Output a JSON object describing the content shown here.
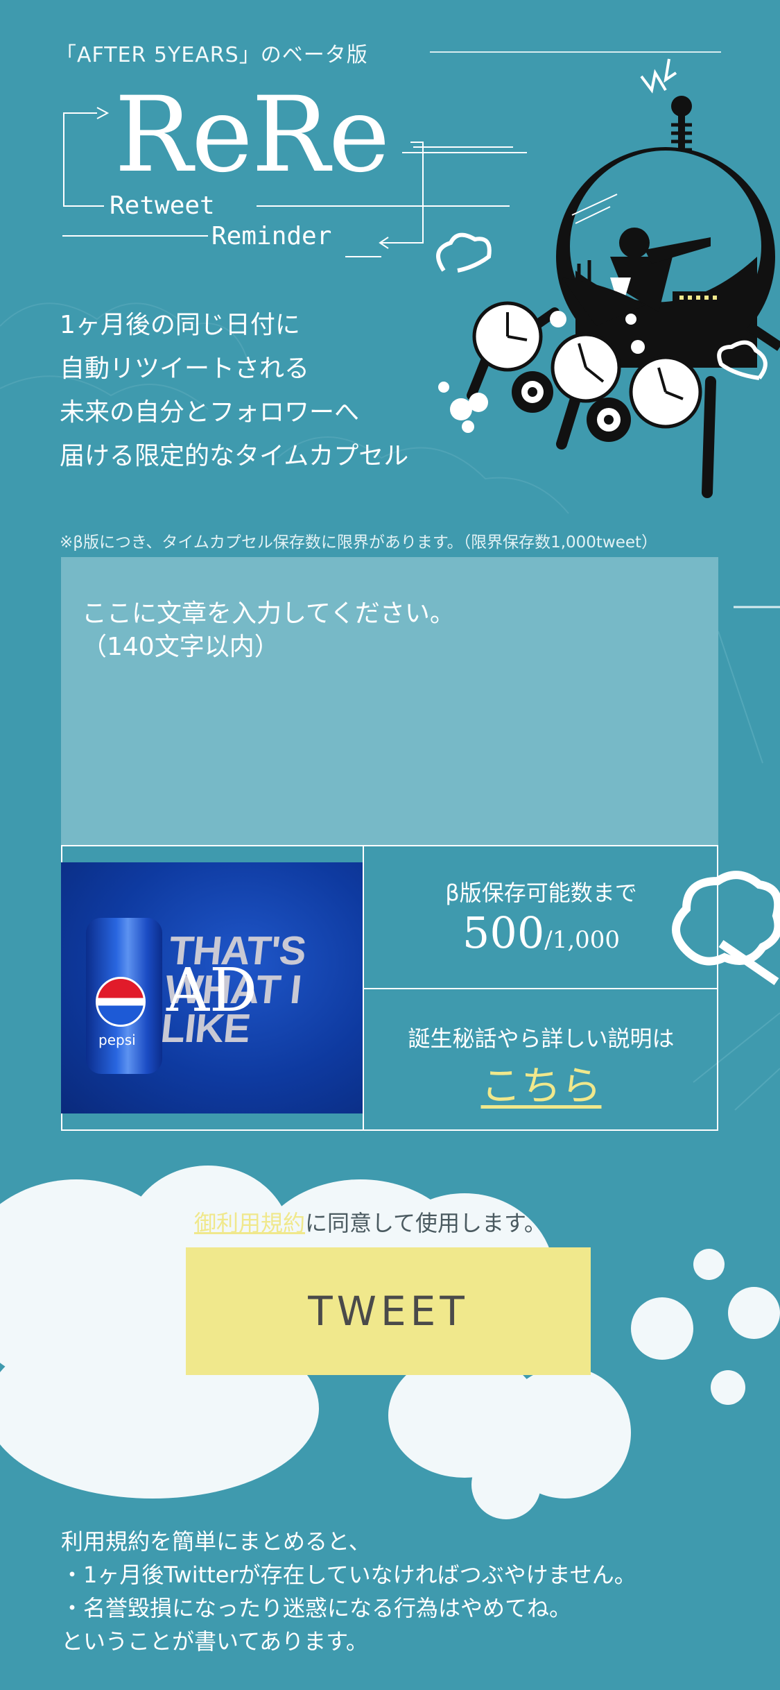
{
  "header": {
    "beta_tag": "「AFTER 5YEARS」のベータ版",
    "logo": "ReRe",
    "logo_sub1": "Retweet",
    "logo_sub2": "Reminder"
  },
  "intro": {
    "lines": [
      "1ヶ月後の同じ日付に",
      "自動リツイートされる",
      "未来の自分とフォロワーへ",
      "届ける限定的なタイムカプセル"
    ]
  },
  "notice": "※β版につき、タイムカプセル保存数に限界があります。（限界保存数1,000tweet）",
  "input": {
    "placeholder": "ここに文章を入力してください。\n（140文字以内）",
    "value": ""
  },
  "ad": {
    "label": "AD",
    "slogan": "THAT'S WHAT I LIKE",
    "brand": "pepsi"
  },
  "remaining": {
    "title": "β版保存可能数まで",
    "count": "500",
    "total": "/1,000"
  },
  "info": {
    "text": "誕生秘話やら詳しい説明は",
    "link": "こちら"
  },
  "agree": {
    "link": "御利用規約",
    "rest": "に同意して使用します。"
  },
  "tweet_button": "TWEET",
  "terms": {
    "lines": [
      "利用規約を簡単にまとめると、",
      "・1ヶ月後Twitterが存在していなければつぶやけません。",
      "・名誉毀損になったり迷惑になる行為はやめてね。",
      "ということが書いてあります。"
    ]
  },
  "colors": {
    "background": "#3f9aae",
    "input_bg": "#77b9c7",
    "accent": "#f0e88c",
    "cloud": "#f2f8fa",
    "illustration": "#111111"
  }
}
